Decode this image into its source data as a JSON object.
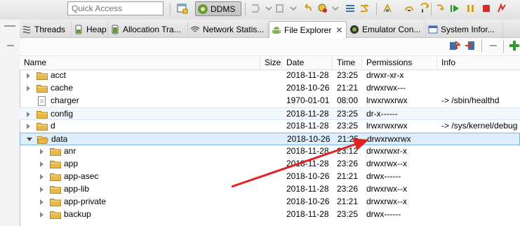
{
  "toolbar": {
    "quick_access_placeholder": "Quick Access",
    "perspective_label": "DDMS",
    "icons": [
      "open-perspective-icon",
      "ddms-perspective-icon",
      "debug-selected-process-icon",
      "update-heap-icon",
      "dump-hprof-icon",
      "cause-gc-icon",
      "update-threads-icon",
      "start-method-profiling-icon",
      "stop-process-icon",
      "screen-capture-icon",
      "reset-adb-icon",
      "step-into-icon",
      "step-over-icon",
      "step-return-icon",
      "resume-icon",
      "suspend-icon",
      "terminate-icon",
      "disconnect-icon"
    ]
  },
  "tabs": [
    {
      "label": "Threads",
      "icon": "threads-icon"
    },
    {
      "label": "Heap",
      "icon": "heap-icon"
    },
    {
      "label": "Allocation Tra...",
      "icon": "allocation-tracker-icon"
    },
    {
      "label": "Network Statis...",
      "icon": "network-statistics-icon"
    },
    {
      "label": "File Explorer",
      "icon": "android-icon",
      "active": true,
      "close": "✕"
    },
    {
      "label": "Emulator Con...",
      "icon": "emulator-control-icon"
    },
    {
      "label": "System Infor...",
      "icon": "system-information-icon"
    }
  ],
  "view_toolbar": {
    "icons": [
      "pull-file-icon",
      "push-file-icon",
      "delete-icon",
      "new-folder-icon"
    ]
  },
  "columns": {
    "name": "Name",
    "size": "Size",
    "date": "Date",
    "time": "Time",
    "permissions": "Permissions",
    "info": "Info"
  },
  "rows": [
    {
      "name": "acct",
      "type": "folder",
      "expand": "closed",
      "level": 0,
      "size": "",
      "date": "2018-11-28",
      "time": "23:25",
      "permissions": "drwxr-xr-x",
      "info": ""
    },
    {
      "name": "cache",
      "type": "folder",
      "expand": "closed",
      "level": 0,
      "size": "",
      "date": "2018-10-26",
      "time": "21:21",
      "permissions": "drwxrwx---",
      "info": ""
    },
    {
      "name": "charger",
      "type": "file",
      "expand": "none",
      "level": 0,
      "size": "",
      "date": "1970-01-01",
      "time": "08:00",
      "permissions": "lrwxrwxrwx",
      "info": "-> /sbin/healthd"
    },
    {
      "name": "config",
      "type": "folder",
      "expand": "closed",
      "level": 0,
      "size": "",
      "date": "2018-11-28",
      "time": "23:25",
      "permissions": "dr-x------",
      "info": "",
      "highlight": true
    },
    {
      "name": "d",
      "type": "folder",
      "expand": "closed",
      "level": 0,
      "size": "",
      "date": "2018-11-28",
      "time": "23:25",
      "permissions": "lrwxrwxrwx",
      "info": "-> /sys/kernel/debug"
    },
    {
      "name": "data",
      "type": "folder",
      "expand": "open",
      "level": 0,
      "size": "",
      "date": "2018-10-26",
      "time": "21:25",
      "permissions": "drwxrwxrwx",
      "info": "",
      "selected": true
    },
    {
      "name": "anr",
      "type": "folder",
      "expand": "closed",
      "level": 1,
      "size": "",
      "date": "2018-11-28",
      "time": "23:12",
      "permissions": "drwxrwxr-x",
      "info": ""
    },
    {
      "name": "app",
      "type": "folder",
      "expand": "closed",
      "level": 1,
      "size": "",
      "date": "2018-11-28",
      "time": "23:26",
      "permissions": "drwxrwx--x",
      "info": ""
    },
    {
      "name": "app-asec",
      "type": "folder",
      "expand": "closed",
      "level": 1,
      "size": "",
      "date": "2018-10-26",
      "time": "21:21",
      "permissions": "drwx------",
      "info": ""
    },
    {
      "name": "app-lib",
      "type": "folder",
      "expand": "closed",
      "level": 1,
      "size": "",
      "date": "2018-11-28",
      "time": "23:26",
      "permissions": "drwxrwx--x",
      "info": ""
    },
    {
      "name": "app-private",
      "type": "folder",
      "expand": "closed",
      "level": 1,
      "size": "",
      "date": "2018-10-26",
      "time": "21:21",
      "permissions": "drwxrwx--x",
      "info": ""
    },
    {
      "name": "backup",
      "type": "folder",
      "expand": "closed",
      "level": 1,
      "size": "",
      "date": "2018-11-28",
      "time": "23:25",
      "permissions": "drwx------",
      "info": ""
    }
  ],
  "colors": {
    "folder": "#e8b84a",
    "selection": "#dfeefd",
    "arrow": "#e02222"
  }
}
